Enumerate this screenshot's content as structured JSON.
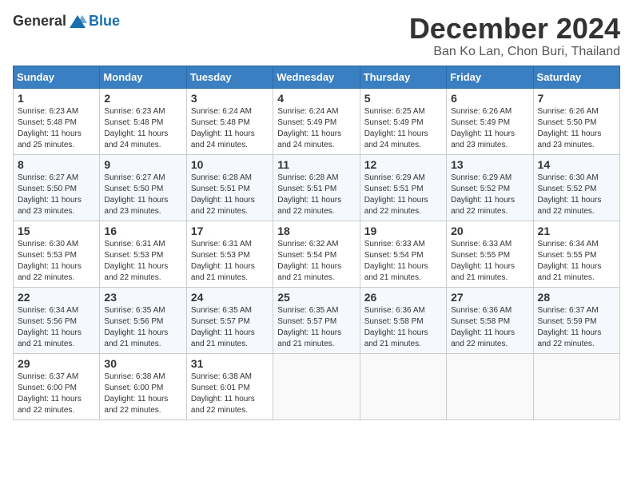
{
  "logo": {
    "general": "General",
    "blue": "Blue"
  },
  "title": "December 2024",
  "subtitle": "Ban Ko Lan, Chon Buri, Thailand",
  "headers": [
    "Sunday",
    "Monday",
    "Tuesday",
    "Wednesday",
    "Thursday",
    "Friday",
    "Saturday"
  ],
  "weeks": [
    [
      {
        "day": "1",
        "sunrise": "6:23 AM",
        "sunset": "5:48 PM",
        "daylight": "11 hours and 25 minutes."
      },
      {
        "day": "2",
        "sunrise": "6:23 AM",
        "sunset": "5:48 PM",
        "daylight": "11 hours and 24 minutes."
      },
      {
        "day": "3",
        "sunrise": "6:24 AM",
        "sunset": "5:48 PM",
        "daylight": "11 hours and 24 minutes."
      },
      {
        "day": "4",
        "sunrise": "6:24 AM",
        "sunset": "5:49 PM",
        "daylight": "11 hours and 24 minutes."
      },
      {
        "day": "5",
        "sunrise": "6:25 AM",
        "sunset": "5:49 PM",
        "daylight": "11 hours and 24 minutes."
      },
      {
        "day": "6",
        "sunrise": "6:26 AM",
        "sunset": "5:49 PM",
        "daylight": "11 hours and 23 minutes."
      },
      {
        "day": "7",
        "sunrise": "6:26 AM",
        "sunset": "5:50 PM",
        "daylight": "11 hours and 23 minutes."
      }
    ],
    [
      {
        "day": "8",
        "sunrise": "6:27 AM",
        "sunset": "5:50 PM",
        "daylight": "11 hours and 23 minutes."
      },
      {
        "day": "9",
        "sunrise": "6:27 AM",
        "sunset": "5:50 PM",
        "daylight": "11 hours and 23 minutes."
      },
      {
        "day": "10",
        "sunrise": "6:28 AM",
        "sunset": "5:51 PM",
        "daylight": "11 hours and 22 minutes."
      },
      {
        "day": "11",
        "sunrise": "6:28 AM",
        "sunset": "5:51 PM",
        "daylight": "11 hours and 22 minutes."
      },
      {
        "day": "12",
        "sunrise": "6:29 AM",
        "sunset": "5:51 PM",
        "daylight": "11 hours and 22 minutes."
      },
      {
        "day": "13",
        "sunrise": "6:29 AM",
        "sunset": "5:52 PM",
        "daylight": "11 hours and 22 minutes."
      },
      {
        "day": "14",
        "sunrise": "6:30 AM",
        "sunset": "5:52 PM",
        "daylight": "11 hours and 22 minutes."
      }
    ],
    [
      {
        "day": "15",
        "sunrise": "6:30 AM",
        "sunset": "5:53 PM",
        "daylight": "11 hours and 22 minutes."
      },
      {
        "day": "16",
        "sunrise": "6:31 AM",
        "sunset": "5:53 PM",
        "daylight": "11 hours and 22 minutes."
      },
      {
        "day": "17",
        "sunrise": "6:31 AM",
        "sunset": "5:53 PM",
        "daylight": "11 hours and 21 minutes."
      },
      {
        "day": "18",
        "sunrise": "6:32 AM",
        "sunset": "5:54 PM",
        "daylight": "11 hours and 21 minutes."
      },
      {
        "day": "19",
        "sunrise": "6:33 AM",
        "sunset": "5:54 PM",
        "daylight": "11 hours and 21 minutes."
      },
      {
        "day": "20",
        "sunrise": "6:33 AM",
        "sunset": "5:55 PM",
        "daylight": "11 hours and 21 minutes."
      },
      {
        "day": "21",
        "sunrise": "6:34 AM",
        "sunset": "5:55 PM",
        "daylight": "11 hours and 21 minutes."
      }
    ],
    [
      {
        "day": "22",
        "sunrise": "6:34 AM",
        "sunset": "5:56 PM",
        "daylight": "11 hours and 21 minutes."
      },
      {
        "day": "23",
        "sunrise": "6:35 AM",
        "sunset": "5:56 PM",
        "daylight": "11 hours and 21 minutes."
      },
      {
        "day": "24",
        "sunrise": "6:35 AM",
        "sunset": "5:57 PM",
        "daylight": "11 hours and 21 minutes."
      },
      {
        "day": "25",
        "sunrise": "6:35 AM",
        "sunset": "5:57 PM",
        "daylight": "11 hours and 21 minutes."
      },
      {
        "day": "26",
        "sunrise": "6:36 AM",
        "sunset": "5:58 PM",
        "daylight": "11 hours and 21 minutes."
      },
      {
        "day": "27",
        "sunrise": "6:36 AM",
        "sunset": "5:58 PM",
        "daylight": "11 hours and 22 minutes."
      },
      {
        "day": "28",
        "sunrise": "6:37 AM",
        "sunset": "5:59 PM",
        "daylight": "11 hours and 22 minutes."
      }
    ],
    [
      {
        "day": "29",
        "sunrise": "6:37 AM",
        "sunset": "6:00 PM",
        "daylight": "11 hours and 22 minutes."
      },
      {
        "day": "30",
        "sunrise": "6:38 AM",
        "sunset": "6:00 PM",
        "daylight": "11 hours and 22 minutes."
      },
      {
        "day": "31",
        "sunrise": "6:38 AM",
        "sunset": "6:01 PM",
        "daylight": "11 hours and 22 minutes."
      },
      null,
      null,
      null,
      null
    ]
  ]
}
